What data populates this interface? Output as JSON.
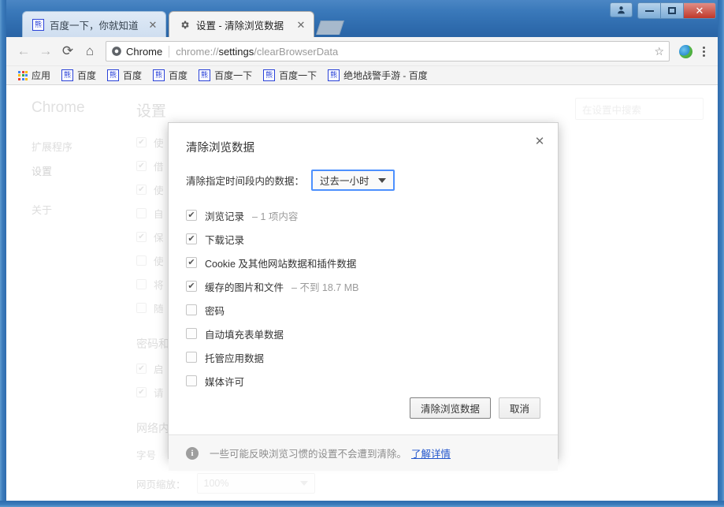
{
  "window": {
    "controls": {
      "person": "person-icon",
      "minimize": "—",
      "maximize": "▢",
      "close": "✕"
    }
  },
  "tabs": [
    {
      "title": "百度一下，你就知道",
      "favicon": "baidu-favicon",
      "close": "✕",
      "active": false
    },
    {
      "title": "设置 - 清除浏览数据",
      "favicon": "gear-icon",
      "close": "✕",
      "active": true
    }
  ],
  "newtab_label": "",
  "toolbar": {
    "back": "←",
    "forward": "→",
    "reload": "⟳",
    "home": "⌂",
    "chrome_badge": "Chrome",
    "url_prefix": "chrome://",
    "url_bold": "settings",
    "url_suffix": "/clearBrowserData",
    "url_full": "chrome://settings/clearBrowserData",
    "star": "☆",
    "extension": "extension-icon",
    "menu": "menu-icon"
  },
  "bookmarks": [
    {
      "label": "应用",
      "icon": "apps-grid-icon"
    },
    {
      "label": "百度",
      "icon": "baidu-favicon"
    },
    {
      "label": "百度",
      "icon": "baidu-favicon"
    },
    {
      "label": "百度",
      "icon": "baidu-favicon"
    },
    {
      "label": "百度一下",
      "icon": "baidu-favicon"
    },
    {
      "label": "百度一下",
      "icon": "baidu-favicon"
    },
    {
      "label": "绝地战警手游 - 百度",
      "icon": "baidu-favicon"
    }
  ],
  "settings_page": {
    "brand": "Chrome",
    "nav": [
      {
        "label": "扩展程序",
        "selected": false
      },
      {
        "label": "设置",
        "selected": true
      },
      {
        "label": "关于",
        "selected": false
      }
    ],
    "title": "设置",
    "search_placeholder": "在设置中搜索",
    "privacy_checks": [
      {
        "label": "使",
        "checked": true
      },
      {
        "label": "借",
        "checked": true
      },
      {
        "label": "使",
        "checked": true
      },
      {
        "label": "自",
        "checked": false
      },
      {
        "label": "保",
        "checked": true
      },
      {
        "label": "使",
        "checked": false
      },
      {
        "label": "将",
        "checked": false
      },
      {
        "label": "随",
        "checked": false
      }
    ],
    "section_passwords": "密码和表单",
    "password_checks": [
      {
        "label": "启",
        "checked": true
      },
      {
        "label": "请",
        "checked": true
      }
    ],
    "section_web": "网络内容",
    "font_size_label": "字号",
    "page_zoom_label": "网页缩放：",
    "page_zoom_value": "100%"
  },
  "dialog": {
    "title": "清除浏览数据",
    "close": "✕",
    "period_label": "清除指定时间段内的数据：",
    "period_value": "过去一小时",
    "items": [
      {
        "label": "浏览记录",
        "sub": "– 1 项内容",
        "checked": true
      },
      {
        "label": "下载记录",
        "sub": "",
        "checked": true
      },
      {
        "label": "Cookie 及其他网站数据和插件数据",
        "sub": "",
        "checked": true
      },
      {
        "label": "缓存的图片和文件",
        "sub": "– 不到 18.7 MB",
        "checked": true
      },
      {
        "label": "密码",
        "sub": "",
        "checked": false
      },
      {
        "label": "自动填充表单数据",
        "sub": "",
        "checked": false
      },
      {
        "label": "托管应用数据",
        "sub": "",
        "checked": false
      },
      {
        "label": "媒体许可",
        "sub": "",
        "checked": false
      }
    ],
    "confirm_label": "清除浏览数据",
    "cancel_label": "取消",
    "footer_text": "一些可能反映浏览习惯的设置不会遭到清除。",
    "footer_link": "了解详情",
    "checkmark": "✔"
  },
  "colors": {
    "titlebar": "#2f6cae",
    "accent_focus": "#4d90fe",
    "link": "#2255cc",
    "close_button": "#c0392b"
  }
}
